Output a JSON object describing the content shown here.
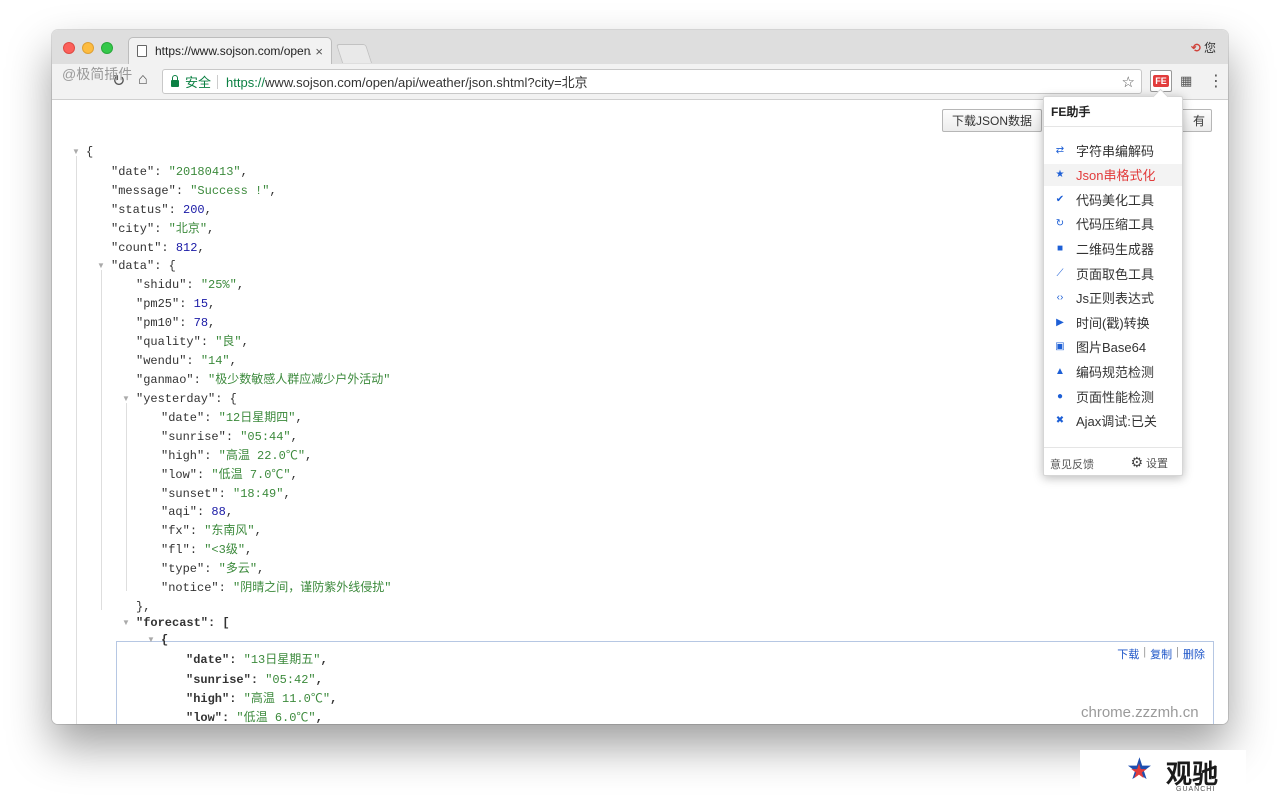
{
  "browser": {
    "tab_title": "https://www.sojson.com/open/",
    "tab_close": "×",
    "profile_label": "您",
    "secure_label": "安全",
    "url_scheme": "https://",
    "url_host": "www.sojson.com",
    "url_path": "/open/api/weather/json.shtml?city=北京",
    "reload_icon": "reload-icon",
    "home_icon": "home-icon",
    "star_icon": "bookmark-star-icon",
    "ext_fe_label": "FE",
    "ext_qr_icon": "qr-code-icon",
    "menu_icon": "kebab-menu-icon"
  },
  "page": {
    "download_json_label": "下载JSON数据",
    "all_label": "有"
  },
  "json_lines": [
    {
      "key": "",
      "val": "{"
    },
    {
      "key": "\"date\"",
      "val": "\"20180413\"",
      "type": "s"
    },
    {
      "key": "\"message\"",
      "val": "\"Success !\"",
      "type": "s"
    },
    {
      "key": "\"status\"",
      "val": "200",
      "type": "n"
    },
    {
      "key": "\"city\"",
      "val": "\"北京\"",
      "type": "s"
    },
    {
      "key": "\"count\"",
      "val": "812",
      "type": "n"
    },
    {
      "key": "\"data\"",
      "val": "{"
    },
    {
      "key": "\"shidu\"",
      "val": "\"25%\"",
      "type": "s"
    },
    {
      "key": "\"pm25\"",
      "val": "15",
      "type": "n"
    },
    {
      "key": "\"pm10\"",
      "val": "78",
      "type": "n"
    },
    {
      "key": "\"quality\"",
      "val": "\"良\"",
      "type": "s"
    },
    {
      "key": "\"wendu\"",
      "val": "\"14\"",
      "type": "s"
    },
    {
      "key": "\"ganmao\"",
      "val": "\"极少数敏感人群应减少户外活动\"",
      "type": "s"
    },
    {
      "key": "\"yesterday\"",
      "val": "{"
    },
    {
      "key": "\"date\"",
      "val": "\"12日星期四\"",
      "type": "s"
    },
    {
      "key": "\"sunrise\"",
      "val": "\"05:44\"",
      "type": "s"
    },
    {
      "key": "\"high\"",
      "val": "\"高温 22.0℃\"",
      "type": "s"
    },
    {
      "key": "\"low\"",
      "val": "\"低温 7.0℃\"",
      "type": "s"
    },
    {
      "key": "\"sunset\"",
      "val": "\"18:49\"",
      "type": "s"
    },
    {
      "key": "\"aqi\"",
      "val": "88",
      "type": "n"
    },
    {
      "key": "\"fx\"",
      "val": "\"东南风\"",
      "type": "s"
    },
    {
      "key": "\"fl\"",
      "val": "\"<3级\"",
      "type": "s"
    },
    {
      "key": "\"type\"",
      "val": "\"多云\"",
      "type": "s"
    },
    {
      "key": "\"notice\"",
      "val": "\"阴晴之间，谨防紫外线侵扰\"",
      "type": "s"
    },
    {
      "key": "",
      "val": "},"
    },
    {
      "key": "\"forecast\"",
      "val": "["
    },
    {
      "key": "",
      "val": "{"
    },
    {
      "key": "\"date\"",
      "val": "\"13日星期五\"",
      "type": "s"
    },
    {
      "key": "\"sunrise\"",
      "val": "\"05:42\"",
      "type": "s"
    },
    {
      "key": "\"high\"",
      "val": "\"高温 11.0℃\"",
      "type": "s"
    },
    {
      "key": "\"low\"",
      "val": "\"低温 6.0℃\"",
      "type": "s"
    }
  ],
  "forecast_actions": {
    "download": "下载",
    "copy": "复制",
    "delete": "删除"
  },
  "fe_helper": {
    "title": "FE助手",
    "items": [
      {
        "label": "字符串编解码",
        "icon": "⇄"
      },
      {
        "label": "Json串格式化",
        "icon": "★"
      },
      {
        "label": "代码美化工具",
        "icon": "✔"
      },
      {
        "label": "代码压缩工具",
        "icon": "↻"
      },
      {
        "label": "二维码生成器",
        "icon": "■"
      },
      {
        "label": "页面取色工具",
        "icon": "⟋"
      },
      {
        "label": "Js正则表达式",
        "icon": "‹›"
      },
      {
        "label": "时间(戳)转换",
        "icon": "▶"
      },
      {
        "label": "图片Base64",
        "icon": "▣"
      },
      {
        "label": "编码规范检测",
        "icon": "▲"
      },
      {
        "label": "页面性能检测",
        "icon": "●"
      },
      {
        "label": "Ajax调试:已关",
        "icon": "✖"
      }
    ],
    "feedback_label": "意见反馈",
    "settings_label": "设置",
    "settings_icon": "gear-icon"
  },
  "watermarks": {
    "top_left": "@极简插件",
    "bottom_right": "chrome.zzzmh.cn",
    "brand_name": "观驰",
    "brand_sub": "GUANCHI"
  }
}
